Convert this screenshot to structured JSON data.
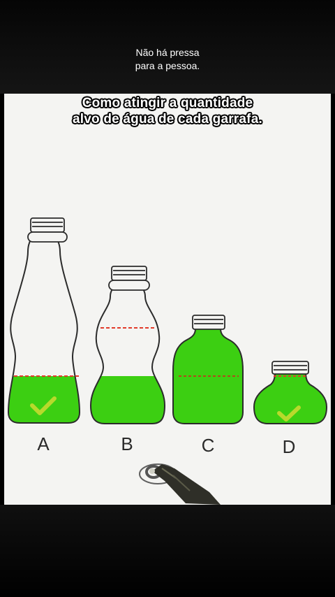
{
  "video_caption": {
    "line1": "Não há pressa",
    "line2": "para a pessoa."
  },
  "puzzle": {
    "title_line1": "Como atingir a quantidade",
    "title_line2": "alvo de água de cada garrafa.",
    "bottles": [
      {
        "label": "A",
        "checked": true
      },
      {
        "label": "B",
        "checked": false
      },
      {
        "label": "C",
        "checked": false
      },
      {
        "label": "D",
        "checked": true
      }
    ]
  },
  "colors": {
    "water": "#3ccf12",
    "target_line": "#e23a2a",
    "checkmark": "#b8d92c",
    "outline": "#2b2b2b"
  },
  "icons": {
    "checkmark": "checkmark-icon",
    "stylus": "stylus-icon"
  }
}
